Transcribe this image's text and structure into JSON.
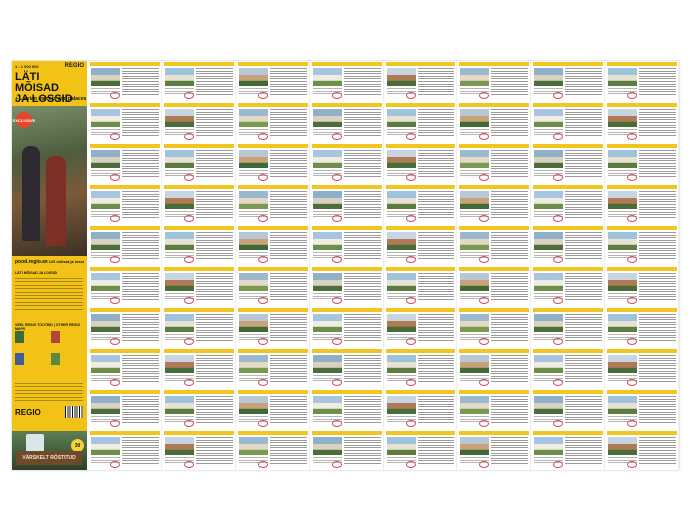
{
  "cover": {
    "scale": "1 : 1 000 000",
    "brand": "REGIO",
    "title_line1": "LÄTI MÕISAD",
    "title_line2": "JA LOSSID",
    "subtitle": "+ Latvian manors and palaces",
    "badge": "EXCLUSIVE",
    "website": "pood.regio.ee",
    "website_note": "120 mõisat ja lossi",
    "intro_title": "LÄTI MÕISAD JA LOSSID",
    "other_title": "VEEL REGIO TOOTEID | OTHER REGIO MAPS",
    "bottom_logo": "REGIO",
    "ad_text": "VÄRSKELT RÖSTITUD",
    "ad_price": "30"
  },
  "accent_color": "#f3c51f",
  "stamp_color": "#d14b5c"
}
